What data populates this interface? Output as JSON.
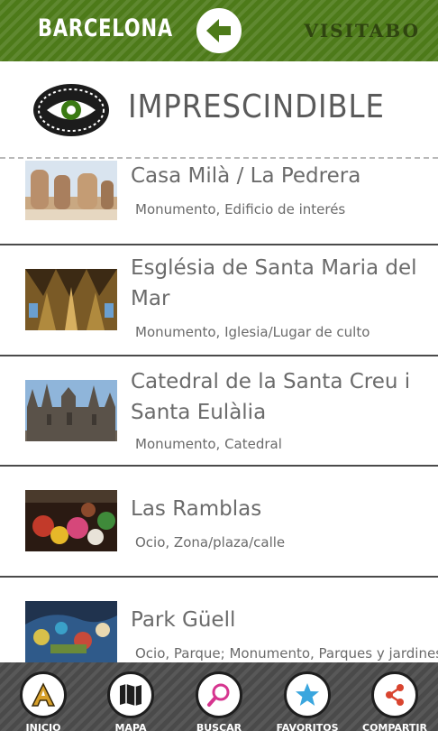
{
  "header": {
    "city": "BARCELONA",
    "brand": "VISITABO",
    "back_icon": "arrow-left-icon",
    "colors": {
      "bar": "#4d7a19",
      "back_arrow": "#4d7a19"
    }
  },
  "section": {
    "title": "IMPRESCINDIBLE",
    "icon": "eye-icon",
    "colors": {
      "badge_ring": "#1c1c1c",
      "eye": "#3a7a12"
    }
  },
  "places": [
    {
      "name": "Casa Milà / La Pedrera",
      "category": "Monumento, Edificio de interés"
    },
    {
      "name": "Església de Santa Maria del Mar",
      "category": "Monumento, Iglesia/Lugar de culto"
    },
    {
      "name": "Catedral de la Santa Creu i Santa Eulàlia",
      "category": "Monumento, Catedral"
    },
    {
      "name": "Las Ramblas",
      "category": "Ocio, Zona/plaza/calle"
    },
    {
      "name": "Park Güell",
      "category": "Ocio, Parque; Monumento, Parques y jardines"
    }
  ],
  "nav": [
    {
      "label": "INICIO",
      "icon": "home-icon"
    },
    {
      "label": "MAPA",
      "icon": "map-icon"
    },
    {
      "label": "BUSCAR",
      "icon": "search-icon"
    },
    {
      "label": "FAVORITOS",
      "icon": "star-icon"
    },
    {
      "label": "COMPARTIR",
      "icon": "share-icon"
    }
  ]
}
